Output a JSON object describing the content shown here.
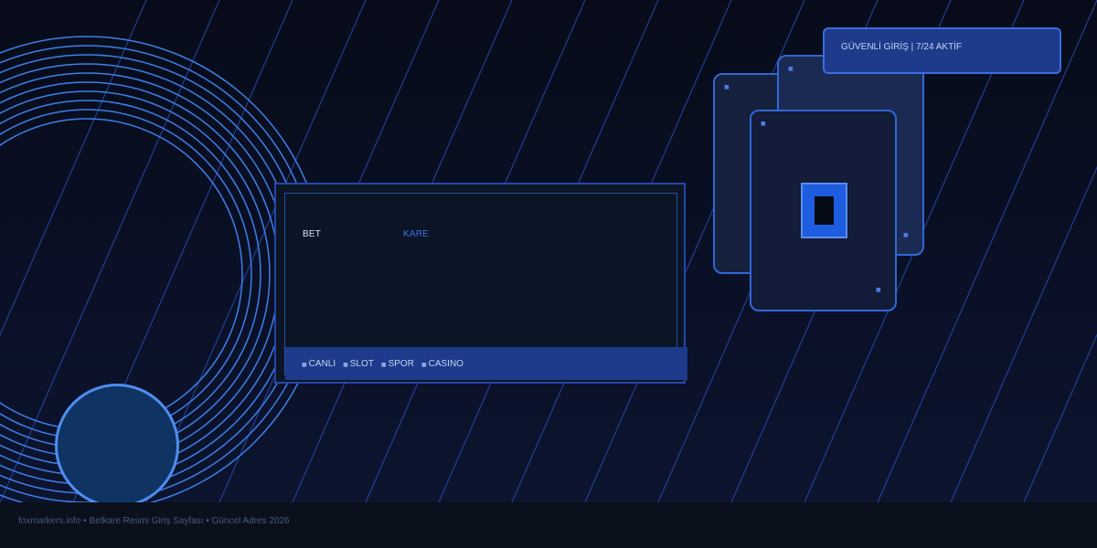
{
  "brand": {
    "part1": "BET",
    "part2": "KARE"
  },
  "menu": {
    "items": [
      {
        "label": "CANLI",
        "icon": "live-icon"
      },
      {
        "label": "SLOT",
        "icon": "slot-icon"
      },
      {
        "label": "SPOR",
        "icon": "sport-icon"
      },
      {
        "label": "CASINO",
        "icon": "casino-icon"
      }
    ]
  },
  "badge": {
    "text": "GÜVENLİ GİRİŞ | 7/24 AKTİF",
    "icon": "shield-icon"
  },
  "footer": {
    "text": "foxmarkers.info • Betkare Resmi Giriş Sayfası • Güncel Adres 2026"
  },
  "colors": {
    "background": "#080c1a",
    "accent": "#1e3a8a",
    "highlight": "#3c6fe0",
    "text": "#c5d3f2"
  }
}
